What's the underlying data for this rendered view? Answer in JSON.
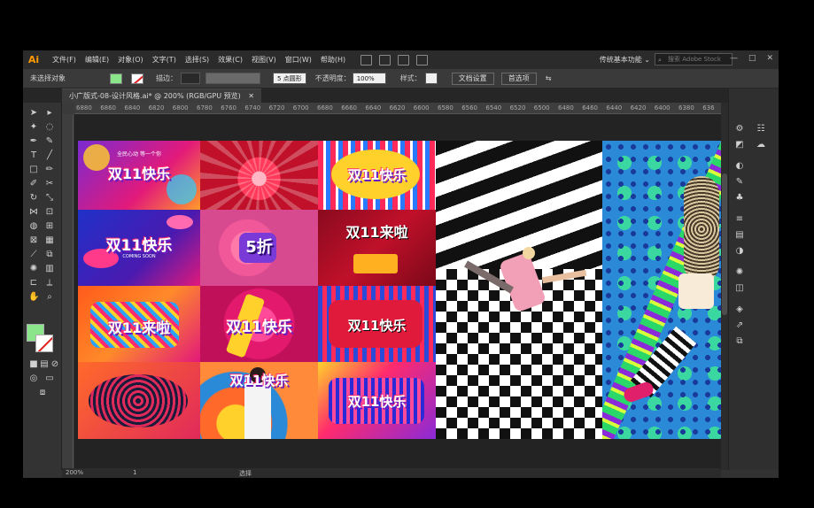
{
  "app": {
    "logo": "Ai"
  },
  "menu": {
    "items": [
      "文件(F)",
      "编辑(E)",
      "对象(O)",
      "文字(T)",
      "选择(S)",
      "效果(C)",
      "视图(V)",
      "窗口(W)",
      "帮助(H)"
    ]
  },
  "workspace": {
    "label": "传统基本功能",
    "chevron": "⌄"
  },
  "search": {
    "placeholder": "搜索 Adobe Stock"
  },
  "window_buttons": {
    "minimize": "—",
    "restore": "□",
    "close": "✕"
  },
  "control_bar": {
    "selection_status": "未选择对象",
    "stroke_label": "描边：",
    "brush_value": "5 点圆形",
    "opacity_label": "不透明度：",
    "opacity_value": "100%",
    "style_label": "样式：",
    "doc_setup_button": "文档设置",
    "preferences_button": "首选项"
  },
  "document": {
    "tab_title": "小广版式-08-设计风格.ai* @ 200% (RGB/GPU 预览)",
    "close": "✕"
  },
  "ruler": {
    "labels": [
      "6880",
      "6860",
      "6840",
      "6820",
      "6800",
      "6780",
      "6760",
      "6740",
      "6720",
      "6700",
      "6680",
      "6660",
      "6640",
      "6620",
      "6600",
      "6580",
      "6560",
      "6540",
      "6520",
      "6500",
      "6480",
      "6460",
      "6440",
      "6420",
      "6400",
      "6380",
      "636"
    ]
  },
  "tiles": [
    {
      "label": "双11快乐",
      "sub": "全民心动 等一个你",
      "bg": "#c21d8a"
    },
    {
      "label": "",
      "bg": "#d8163b"
    },
    {
      "label": "双11快乐",
      "bg": "#e23a58"
    },
    {
      "label": "双11快乐",
      "sub": "COMING SOON",
      "bg": "#2a31c4"
    },
    {
      "label": "5折",
      "bg": "#f06a9a"
    },
    {
      "label": "双11来啦",
      "bg": "#b80f2a"
    },
    {
      "label": "双11来啦",
      "bg": "#ff7a1a"
    },
    {
      "label": "双11快乐",
      "bg": "#e3196e"
    },
    {
      "label": "双11快乐",
      "bg": "#d61e3c"
    },
    {
      "label": "",
      "bg": "#e02a5a"
    },
    {
      "label": "双11快乐",
      "bg": "#ff8a3a"
    },
    {
      "label": "双11快乐",
      "bg": "#8a2ad8"
    }
  ],
  "status": {
    "zoom": "200%",
    "page": "1",
    "mode": "选择"
  }
}
